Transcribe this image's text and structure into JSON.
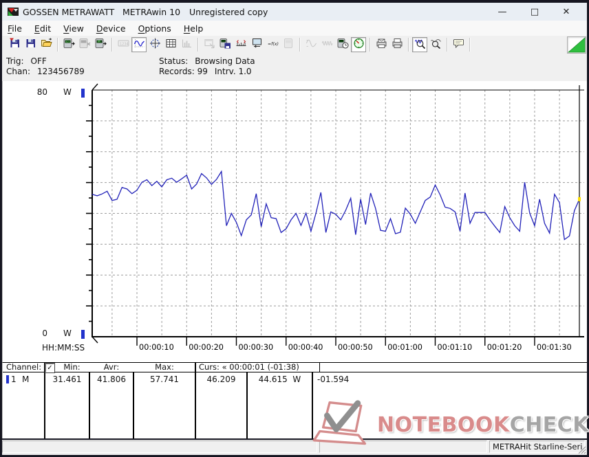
{
  "window": {
    "app_name": "GOSSEN METRAWATT",
    "product_name": "METRAwin 10",
    "license_note": "Unregistered copy",
    "controls": {
      "minimize": "—",
      "maximize": "□",
      "close": "✕"
    }
  },
  "menu": {
    "items": [
      {
        "label": "File"
      },
      {
        "label": "Edit"
      },
      {
        "label": "View"
      },
      {
        "label": "Device"
      },
      {
        "label": "Options"
      },
      {
        "label": "Help"
      }
    ]
  },
  "toolbar": {
    "buttons": [
      {
        "icon": "import-file-icon",
        "state": "normal"
      },
      {
        "icon": "save-file-icon",
        "state": "normal"
      },
      {
        "icon": "open-file-icon",
        "state": "normal"
      },
      {
        "sep": true
      },
      {
        "icon": "read-device-icon",
        "state": "normal"
      },
      {
        "icon": "device-offline-icon",
        "state": "disabled"
      },
      {
        "icon": "device-memory-icon",
        "state": "normal"
      },
      {
        "sep": true
      },
      {
        "icon": "numeric-display-icon",
        "state": "disabled"
      },
      {
        "icon": "chart-view-icon",
        "state": "active"
      },
      {
        "icon": "cursor-view-icon",
        "state": "normal"
      },
      {
        "icon": "table-view-icon",
        "state": "normal"
      },
      {
        "icon": "histogram-view-icon",
        "state": "disabled"
      },
      {
        "sep": true
      },
      {
        "icon": "export-window-icon",
        "state": "disabled"
      },
      {
        "icon": "store-device-icon",
        "state": "normal"
      },
      {
        "icon": "scale-settings-icon",
        "state": "normal"
      },
      {
        "icon": "monitor-settings-icon",
        "state": "normal"
      },
      {
        "icon": "formula-icon",
        "state": "normal"
      },
      {
        "icon": "device-config-icon",
        "state": "disabled"
      },
      {
        "sep": true
      },
      {
        "icon": "wave-single-icon",
        "state": "disabled"
      },
      {
        "icon": "wave-continuous-icon",
        "state": "disabled"
      },
      {
        "icon": "timer-device-icon",
        "state": "normal"
      },
      {
        "icon": "meter-dial-icon",
        "state": "active"
      },
      {
        "sep": true
      },
      {
        "icon": "print-preview-icon",
        "state": "normal"
      },
      {
        "icon": "print-icon",
        "state": "normal"
      },
      {
        "sep": true
      },
      {
        "icon": "zoom-in-curve-icon",
        "state": "active"
      },
      {
        "icon": "zoom-out-curve-icon",
        "state": "normal"
      },
      {
        "sep": true
      },
      {
        "icon": "annotation-icon",
        "state": "normal"
      },
      {
        "sep": true
      }
    ]
  },
  "acquisition": {
    "trig_label": "Trig:",
    "trig_value": "OFF",
    "chan_label": "Chan:",
    "chan_value": "123456789",
    "status_label": "Status:",
    "status_value": "Browsing Data",
    "records_label": "Records:",
    "records_value": "99",
    "interval_label": "Intrv.",
    "interval_value": "1.0"
  },
  "chart_data": {
    "type": "line",
    "title": "",
    "unit": "W",
    "ylabel_top": "80",
    "ylabel_bottom": "0",
    "unit_top": "W",
    "unit_bottom": "W",
    "time_axis_format": "HH:MM:SS",
    "ylim": [
      0,
      80
    ],
    "grid": {
      "vertical_every_s": 5,
      "horizontal_every_w": 10,
      "style": "dashed"
    },
    "x_start_s": 1,
    "x_end_s": 99,
    "interval_s": 1.0,
    "x_tick_labels": [
      "00:00:10",
      "00:00:20",
      "00:00:30",
      "00:00:40",
      "00:00:50",
      "00:01:00",
      "00:01:10",
      "00:01:20",
      "00:01:30"
    ],
    "series": [
      {
        "name": "Channel 1 power (W)",
        "color": "#2121b8",
        "values": [
          46.2,
          45.7,
          46.3,
          47.2,
          44.2,
          44.6,
          48.4,
          47.9,
          46.4,
          47.5,
          50.1,
          50.9,
          49.0,
          50.4,
          48.6,
          50.9,
          51.4,
          50.1,
          51.2,
          52.4,
          47.9,
          49.5,
          52.9,
          51.5,
          49.4,
          51.0,
          53.6,
          36.0,
          40.0,
          37.1,
          32.8,
          37.9,
          39.5,
          46.4,
          35.7,
          43.1,
          38.6,
          38.3,
          33.8,
          35.0,
          37.9,
          40.0,
          36.1,
          40.1,
          34.2,
          40.0,
          46.8,
          33.8,
          40.5,
          39.7,
          37.9,
          41.0,
          44.9,
          33.1,
          44.6,
          36.4,
          46.6,
          41.6,
          34.5,
          34.2,
          38.3,
          33.4,
          33.9,
          41.7,
          39.7,
          36.8,
          40.5,
          44.2,
          45.3,
          49.2,
          46.0,
          42.0,
          41.6,
          40.5,
          34.2,
          46.6,
          36.8,
          40.3,
          40.3,
          40.3,
          37.9,
          35.8,
          33.8,
          42.2,
          38.6,
          36.0,
          34.2,
          50.1,
          40.1,
          36.0,
          44.6,
          36.8,
          33.6,
          46.2,
          43.5,
          31.5,
          32.7,
          40.9,
          44.6
        ]
      }
    ],
    "cursors": {
      "cursor1_time_s": 1,
      "cursor2_time_s": 99,
      "cursor2_value_w": 44.6
    }
  },
  "bottom_table": {
    "header": {
      "channel": "Channel:",
      "checkbox_checked": true,
      "checkbox_glyph": "✓",
      "min": "Min:",
      "avr": "Avr:",
      "max": "Max:",
      "curs": "Curs: « 00:00:01 (-01:38)"
    },
    "row": {
      "channel": "1",
      "mode": "M",
      "min": "31.461",
      "avr": "41.806",
      "max": "57.741",
      "curs_a": "46.209",
      "curs_b": "44.615",
      "unit": "W",
      "delta": "-01.594"
    }
  },
  "watermark": {
    "word1": "NOTEBOOK",
    "word2": "CHECK"
  },
  "status_bar": {
    "left": "",
    "middle": "",
    "right": "METRAHit Starline-Seri"
  },
  "colors": {
    "trace": "#2121b8",
    "channel_marker": "#2233cc",
    "indicator_green": "#2fbf3f",
    "watermark_red": "#d98b8b",
    "watermark_gray": "#a5a5a5",
    "grid": "#9c9c9c"
  }
}
